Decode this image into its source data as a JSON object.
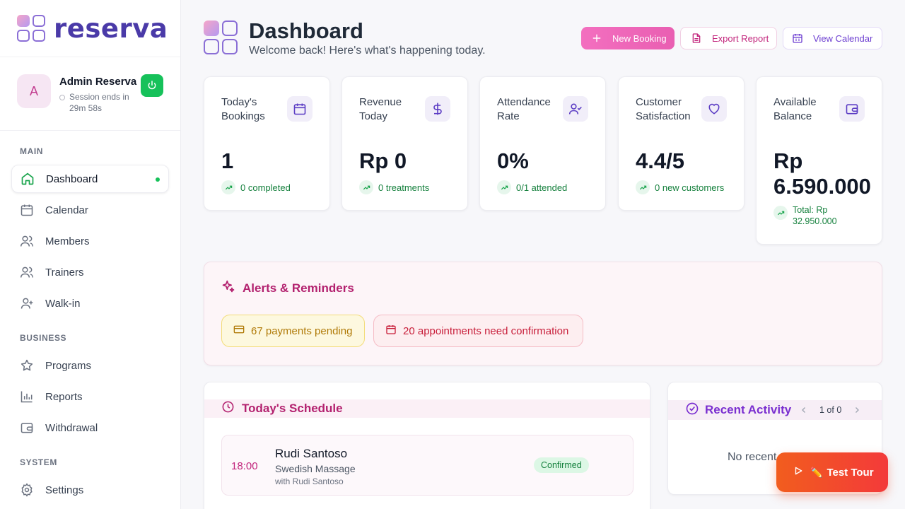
{
  "app": {
    "brand": "reserva",
    "brand_color": "#4a3aa8",
    "accent_pink": "#e95fb2",
    "success_green": "#16c15a"
  },
  "user": {
    "avatar_initial": "A",
    "name": "Admin Reserva",
    "session": "Session ends in 29m 58s"
  },
  "sidebar": {
    "sections": [
      {
        "heading": "MAIN",
        "items": [
          {
            "label": "Dashboard",
            "icon": "home-icon",
            "active": true
          },
          {
            "label": "Calendar",
            "icon": "calendar-icon"
          },
          {
            "label": "Members",
            "icon": "users-icon"
          },
          {
            "label": "Trainers",
            "icon": "users-icon"
          },
          {
            "label": "Walk-in",
            "icon": "user-plus-icon"
          }
        ]
      },
      {
        "heading": "BUSINESS",
        "items": [
          {
            "label": "Programs",
            "icon": "star-icon"
          },
          {
            "label": "Reports",
            "icon": "bar-chart-icon"
          },
          {
            "label": "Withdrawal",
            "icon": "wallet-icon"
          }
        ]
      },
      {
        "heading": "SYSTEM",
        "items": [
          {
            "label": "Settings",
            "icon": "gear-icon"
          }
        ]
      }
    ]
  },
  "header": {
    "title": "Dashboard",
    "subtitle": "Welcome back! Here's what's happening today.",
    "buttons": {
      "new_booking": "New Booking",
      "export_report": "Export Report",
      "view_calendar": "View Calendar"
    }
  },
  "stats": [
    {
      "label": "Today's Bookings",
      "icon": "calendar-icon",
      "value": "1",
      "trend": "0 completed"
    },
    {
      "label": "Revenue Today",
      "icon": "dollar-icon",
      "value": "Rp 0",
      "trend": "0 treatments"
    },
    {
      "label": "Attendance Rate",
      "icon": "user-check-icon",
      "value": "0%",
      "trend": "0/1 attended"
    },
    {
      "label": "Customer Satisfaction",
      "icon": "heart-icon",
      "value": "4.4/5",
      "trend": "0 new customers"
    },
    {
      "label": "Available Balance",
      "icon": "wallet-icon",
      "value": "Rp 6.590.000",
      "trend": "Total: Rp 32.950.000"
    }
  ],
  "alerts": {
    "title": "Alerts & Reminders",
    "items": [
      {
        "text": "67 payments pending",
        "icon": "credit-card-icon"
      },
      {
        "text": "20 appointments need confirmation",
        "icon": "calendar-icon"
      }
    ]
  },
  "schedule": {
    "title": "Today's Schedule",
    "items": [
      {
        "time": "18:00",
        "name": "Rudi Santoso",
        "service": "Swedish Massage",
        "with": "with Rudi Santoso",
        "status": "Confirmed"
      }
    ]
  },
  "activity": {
    "title": "Recent Activity",
    "pager": "1 of 0",
    "empty": "No recent"
  },
  "tour": {
    "label": "Test Tour",
    "emoji": "✏️"
  }
}
